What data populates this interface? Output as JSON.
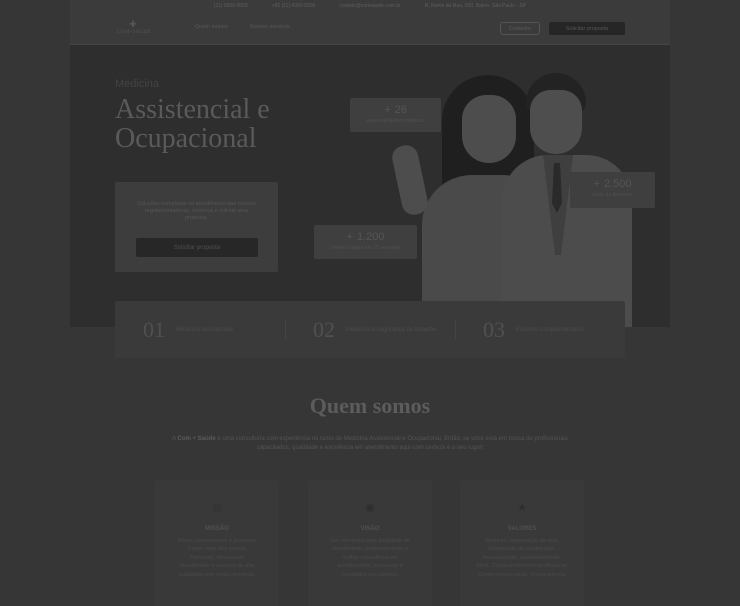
{
  "topbar": {
    "phone1": "(11) 0000-0000",
    "phone2": "+55 (11) 0000-0000",
    "email": "contato@comsaude.com.br",
    "address": "R. Nome da Rua, 000, Bairro, São Paulo - SP"
  },
  "header": {
    "logo_text": "COM+SAÚDE",
    "nav": [
      "Quem somos",
      "Nossos serviços"
    ],
    "login_label": "Cadastre",
    "cta_label": "Solicitar proposta"
  },
  "hero": {
    "eyebrow": "Medicina",
    "title": "Assistencial e Ocupacional",
    "card_text": "Soluções completas no atendimento das normas regulamentadoras, conheça e solicite uma proposta.",
    "card_button": "Solicitar proposta",
    "stats": [
      {
        "value": "26",
        "label": "especialidades médicas"
      },
      {
        "value": "2.500",
        "label": "tipos de Exames"
      },
      {
        "value": "1.200",
        "label": "credenciados em 25 estados"
      }
    ]
  },
  "services": [
    {
      "num": "01",
      "label": "Medicina assistencial"
    },
    {
      "num": "02",
      "label": "Medicina e segurança do trabalho"
    },
    {
      "num": "03",
      "label": "Exames complementares"
    }
  ],
  "about": {
    "title": "Quem somos",
    "brand": "Com + Saúde",
    "text_before": "A ",
    "text_after": " é uma consultoria com experiência no ramo de Medicina Assistencial e Ocupacional. Então, se você está em busca de profissionais capacitados, qualidade e excelência em atendimento aqui com certeza é o seu lugar!",
    "cards": [
      {
        "icon": "target-icon",
        "title": "MISSÃO",
        "text": "Nosso compromisso é promover o bem estar dos nossos Parceiros, oferecendo atendimento e serviços de alta qualidade com ampla presteza."
      },
      {
        "icon": "eye-icon",
        "title": "VISÃO",
        "text": "Ser referência pela qualidade de atendimento, proporcionando a melhor experiência em atendimentos, processos e resultados aos clientes."
      },
      {
        "icon": "star-icon",
        "title": "VALORES",
        "text": "Respeito, Valorização da vida, Valorização do colaborador, Humanização, Sustentabilidade, Ética, Comprometimento profissional, Compromisso social, Transparência."
      }
    ]
  }
}
